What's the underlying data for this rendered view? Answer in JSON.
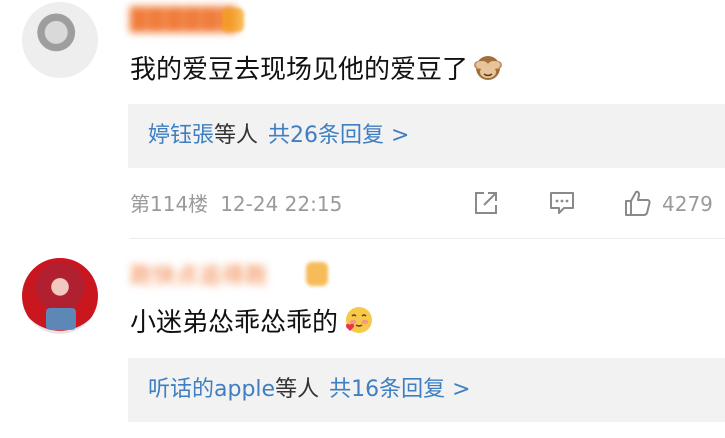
{
  "comments": [
    {
      "username": "██████",
      "text": "我的爱豆去现场见他的爱豆了",
      "emoji": "see-no-evil-monkey-emoji",
      "reply_who": "婷钰張",
      "reply_mid": "等人",
      "reply_count": "共26条回复 >",
      "floor": "第114楼",
      "time": "12-24 22:15",
      "likes": "4279"
    },
    {
      "username": "跑快点追得跑",
      "text": "小迷弟怂乖怂乖的",
      "emoji": "blushing-hearts-emoji",
      "reply_who": "听话的apple",
      "reply_mid": "等人",
      "reply_count": "共16条回复 >"
    }
  ],
  "icons": {
    "share": "share-icon",
    "comment": "comment-icon",
    "like": "thumbs-up-icon"
  },
  "colors": {
    "link": "#3f7fc1",
    "meta": "#9a9a9a",
    "reply_bg": "#f2f2f2",
    "username": "#f07c3a"
  }
}
